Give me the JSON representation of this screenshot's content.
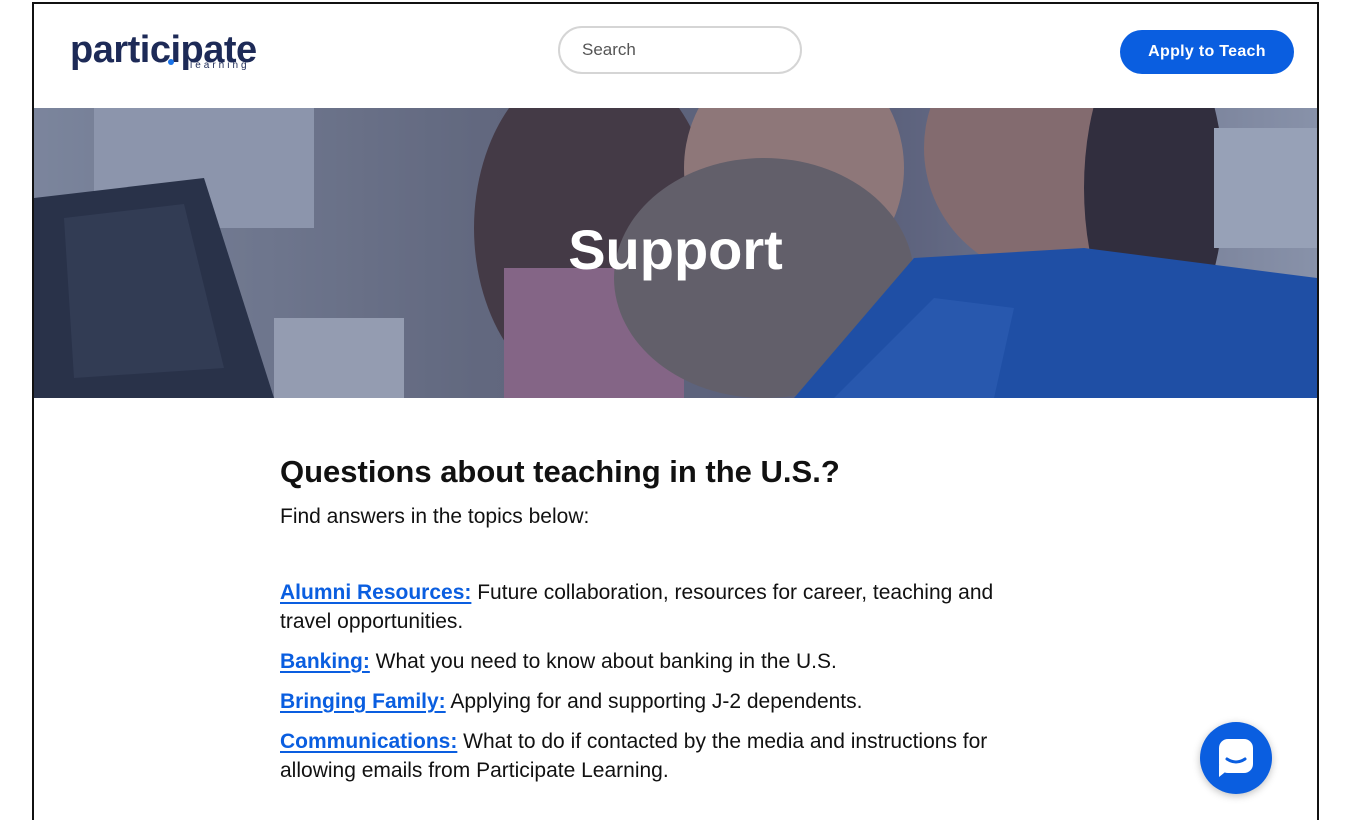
{
  "header": {
    "logo_main": "participate",
    "logo_sub": "learning",
    "search_placeholder": "Search",
    "apply_label": "Apply to Teach"
  },
  "hero": {
    "title": "Support"
  },
  "main": {
    "heading": "Questions about teaching in the U.S.?",
    "intro": "Find answers in the topics below:",
    "topics": [
      {
        "link": "Alumni Resources:",
        "text": " Future collaboration, resources for career, teaching and travel opportunities."
      },
      {
        "link": "Banking:",
        "text": " What you need to know about banking in the U.S."
      },
      {
        "link": "Bringing Family:",
        "text": " Applying for and supporting J-2 dependents."
      },
      {
        "link": "Communications:",
        "text": " What to do if contacted by the media and instructions for allowing emails from Participate Learning."
      }
    ]
  },
  "colors": {
    "brand_navy": "#1d2a57",
    "accent_blue": "#0a5ee0"
  },
  "icons": {
    "chat": "chat-bubble-icon"
  }
}
